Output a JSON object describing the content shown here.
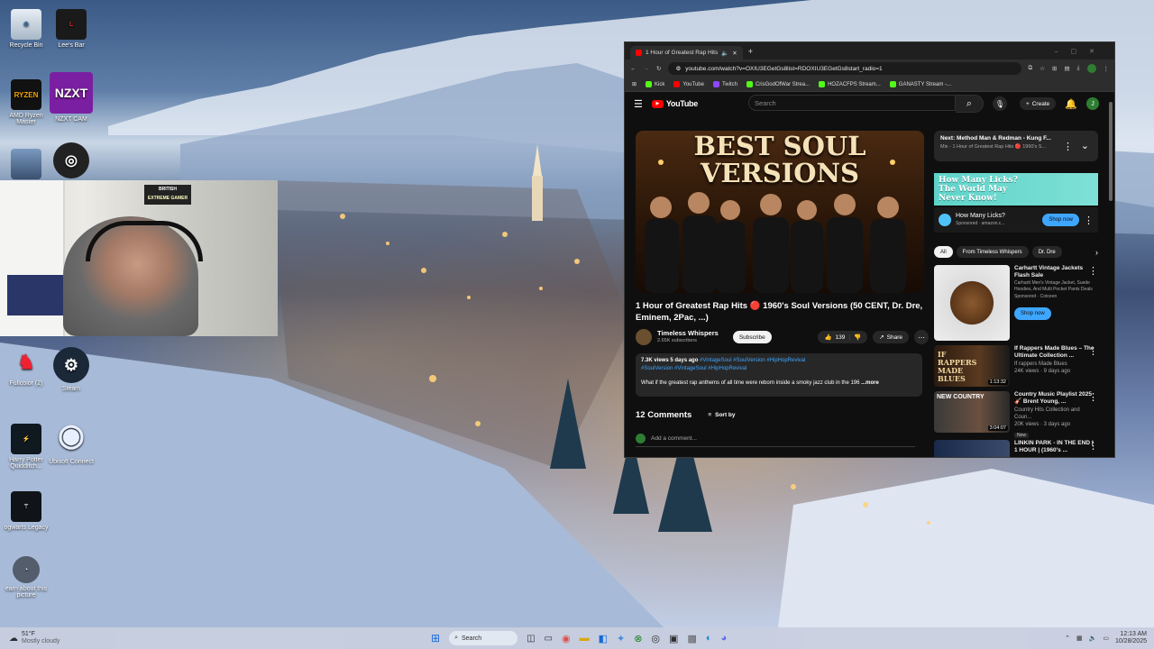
{
  "desktop": {
    "icons": [
      {
        "label": "Recycle Bin",
        "icon": "recycle-bin-icon"
      },
      {
        "label": "Lee's Bar",
        "icon": "app-icon"
      },
      {
        "label": "AMD Ryzen Master",
        "icon": "ryzen-icon"
      },
      {
        "label": "NZXT CAM",
        "icon": "nzxt-icon"
      },
      {
        "label": "",
        "icon": "game-icon"
      },
      {
        "label": "",
        "icon": "obs-icon"
      },
      {
        "label": "Fullcolor (2)",
        "icon": "mario-icon"
      },
      {
        "label": "Steam",
        "icon": "steam-icon"
      },
      {
        "label": "Harry Potter Quidditch...",
        "icon": "game-icon"
      },
      {
        "label": "Ubisoft Connect",
        "icon": "ubisoft-icon"
      },
      {
        "label": "ogwarts Legacy",
        "icon": "game-icon"
      },
      {
        "label": "earn about this picture",
        "icon": "spotlight-icon"
      }
    ],
    "nzxt_text": "NZXT",
    "webcam_sign_line1": "BRITISH",
    "webcam_sign_line2": "EXTREME GAMER"
  },
  "taskbar": {
    "weather_temp": "51°F",
    "weather_desc": "Mostly cloudy",
    "search_placeholder": "Search",
    "time": "12:13 AM",
    "date": "10/28/2025"
  },
  "browser": {
    "tab_title": "1 Hour of Greatest Rap Hits",
    "url": "youtube.com/watch?v=OXIU3EGetGs8list=RDOXIU3EGetGs8start_radio=1",
    "bookmarks": [
      {
        "label": "Kick",
        "color": "#53fc18"
      },
      {
        "label": "YouTube",
        "color": "#ff0000"
      },
      {
        "label": "Twitch",
        "color": "#9146ff"
      },
      {
        "label": "CrisGodOfWar Strea...",
        "color": "#53fc18"
      },
      {
        "label": "HOZACFPS Stream...",
        "color": "#53fc18"
      },
      {
        "label": "GANASTY Stream -...",
        "color": "#53fc18"
      }
    ]
  },
  "youtube": {
    "logo_text": "YouTube",
    "search_placeholder": "Search",
    "create_label": "Create",
    "avatar_letter": "J",
    "thumbnail_text_line1": "BEST SOUL",
    "thumbnail_text_line2": "VERSIONS",
    "video_title": "1 Hour of Greatest Rap Hits 🔴 1960's Soul Versions (50 CENT, Dr. Dre, Eminem, 2Pac, ...)",
    "channel_name": "Timeless Whispers",
    "subscribers": "2.65K subscribers",
    "subscribe_label": "Subscribe",
    "likes": "139",
    "share_label": "Share",
    "views_date": "7.3K views  5 days ago",
    "tags_line1": "#VintageSoul #SoulVersion #HipHopRevival",
    "tags_line2": "#SoulVersion #VintageSoul #HipHopRevival",
    "description": "What if the greatest rap anthems of all time were reborn inside a smoky jazz club in the 196",
    "more_label": "...more",
    "comments_count": "12 Comments",
    "sort_label": "Sort by",
    "add_comment_placeholder": "Add a comment...",
    "next_label": "Next: Method Man & Redman - Kung F...",
    "next_sub": "Mix - 1 Hour of Greatest Rap Hits 🔴 1960's S...",
    "ad_banner_line1": "How Many Licks?",
    "ad_banner_line2": "The World May",
    "ad_banner_line3": "Never Know!",
    "ad_title": "How Many Licks?",
    "ad_sponsor": "Sponsored · amazon.c...",
    "ad_shop_label": "Shop now",
    "chips": [
      "All",
      "From Timeless Whispers",
      "Dr. Dre"
    ],
    "sponsored_product": {
      "title": "Carhartt Vintage Jackets Flash Sale",
      "desc": "Carhartt Men's Vintage Jacket, Suede Hoodies, And Multi Pocket Pants Deals",
      "sponsor": "Sponsored · Cotceen",
      "cta": "Shop now"
    },
    "related": [
      {
        "title": "If Rappers Made Blues – The Ultimate Collection ...",
        "channel": "If rappers Made Blues",
        "meta": "24K views · 9 days ago",
        "duration": "1:13:32",
        "thumb_text": "IF RAPPERS MADE BLUES"
      },
      {
        "title": "Country Music Playlist 2025 🎸 Brent Young, ...",
        "channel": "Country Hits Collection and Coun...",
        "meta": "20K views · 3 days ago",
        "badge": "New",
        "duration": "3:04:07",
        "thumb_text": "NEW COUNTRY"
      },
      {
        "title": "LINKIN PARK - IN THE END | 1 HOUR | (1960's ...",
        "channel": "",
        "meta": "",
        "duration": "",
        "thumb_text": ""
      }
    ]
  }
}
